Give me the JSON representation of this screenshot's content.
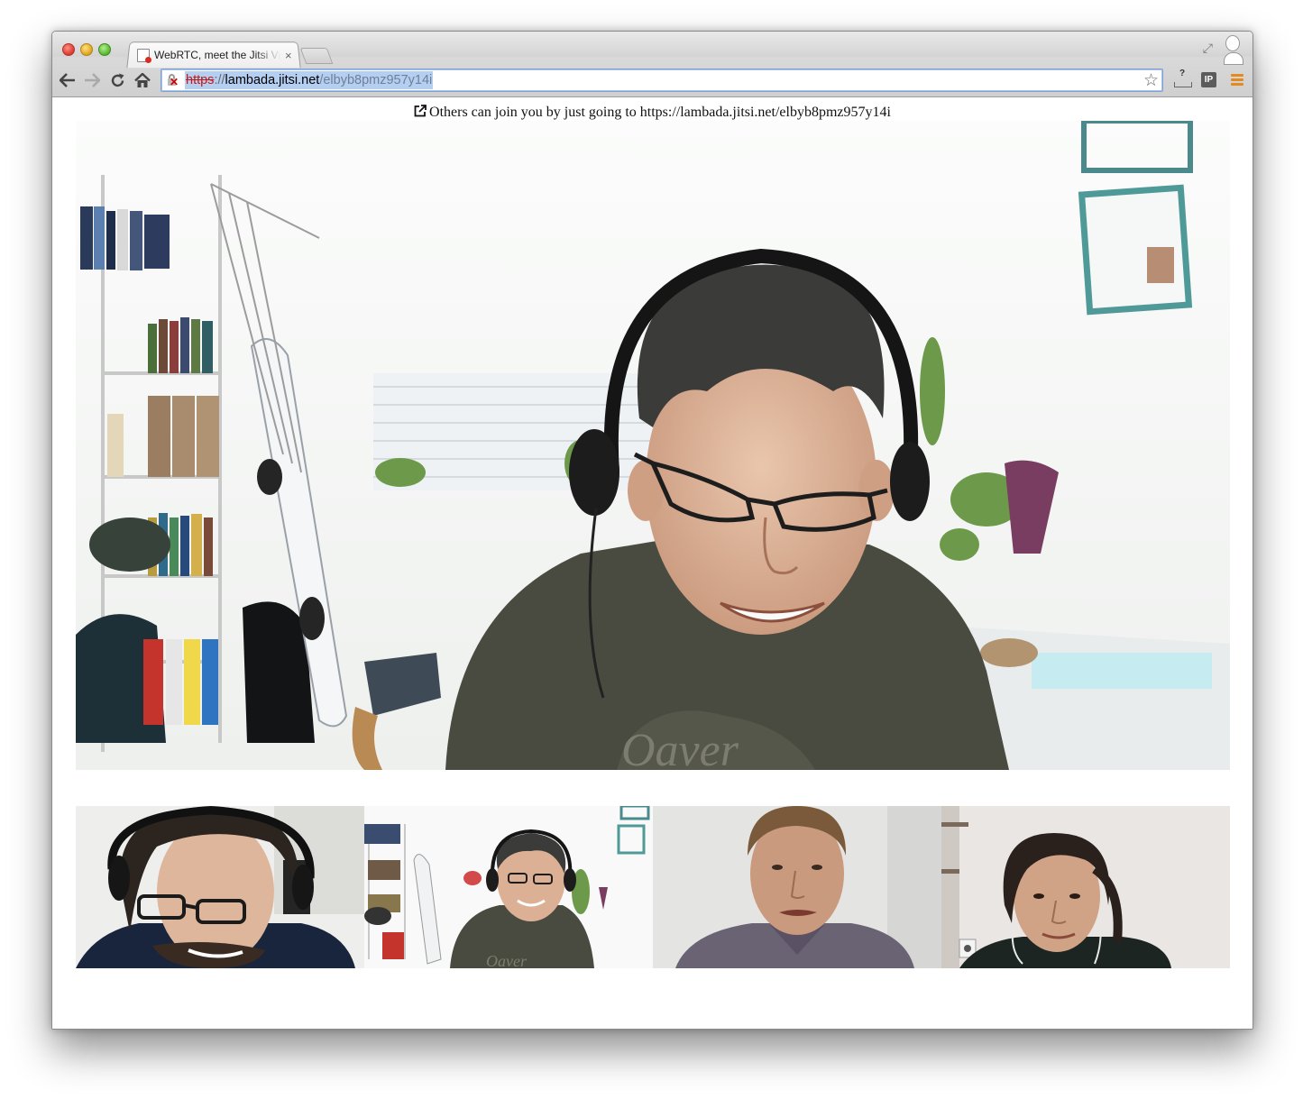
{
  "browser": {
    "tab_title": "WebRTC, meet the Jitsi Vid",
    "tab_close": "×",
    "url": {
      "scheme": "https",
      "separator": "://",
      "host": "lambada.jitsi.net",
      "path": "/elbyb8pmz957y14i"
    },
    "extension_ip_label": "IP",
    "extension_download_label": "?"
  },
  "page": {
    "invite_text": "Others can join you by just going to https://lambada.jitsi.net/elbyb8pmz957y14i"
  },
  "icons": {
    "back": "arrow-left-icon",
    "forward": "arrow-right-icon",
    "reload": "reload-icon",
    "home": "home-icon",
    "star": "star-icon",
    "menu": "hamburger-menu-icon",
    "external_link": "external-link-icon"
  },
  "colors": {
    "menu_accent": "#e58a1f",
    "insecure_scheme": "#c41a14",
    "selection": "#b4cff2"
  }
}
